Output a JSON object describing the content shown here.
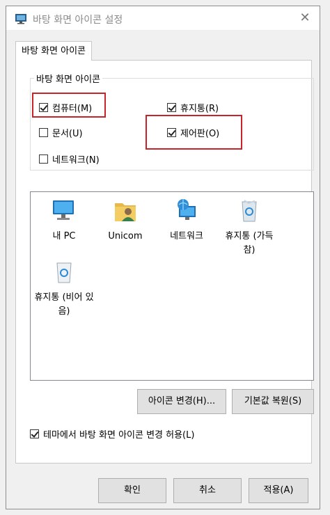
{
  "window": {
    "title": "바탕 화면 아이콘 설정",
    "close_glyph": "✕"
  },
  "tab": {
    "label": "바탕 화면 아이콘"
  },
  "group": {
    "legend": "바탕 화면 아이콘",
    "checkboxes": [
      {
        "label": "컴퓨터(M)",
        "checked": true
      },
      {
        "label": "휴지통(R)",
        "checked": true
      },
      {
        "label": "문서(U)",
        "checked": false
      },
      {
        "label": "제어판(O)",
        "checked": true
      },
      {
        "label": "네트워크(N)",
        "checked": false
      }
    ]
  },
  "icons": [
    {
      "label": "내 PC",
      "icon": "pc-icon"
    },
    {
      "label": "Unicom",
      "icon": "user-folder-icon"
    },
    {
      "label": "네트워크",
      "icon": "network-icon"
    },
    {
      "label": "휴지통 (가득 참)",
      "icon": "recycle-bin-full-icon"
    },
    {
      "label": "휴지통 (비어 있음)",
      "icon": "recycle-bin-empty-icon"
    }
  ],
  "buttons": {
    "change_icon": "아이콘 변경(H)...",
    "restore_default": "기본값 복원(S)"
  },
  "theme_checkbox": {
    "label": "테마에서 바탕 화면 아이콘 변경 허용(L)",
    "checked": true
  },
  "footer": {
    "ok": "확인",
    "cancel": "취소",
    "apply": "적용(A)"
  },
  "colors": {
    "highlight": "#c9232a",
    "accent": "#0078d7"
  }
}
